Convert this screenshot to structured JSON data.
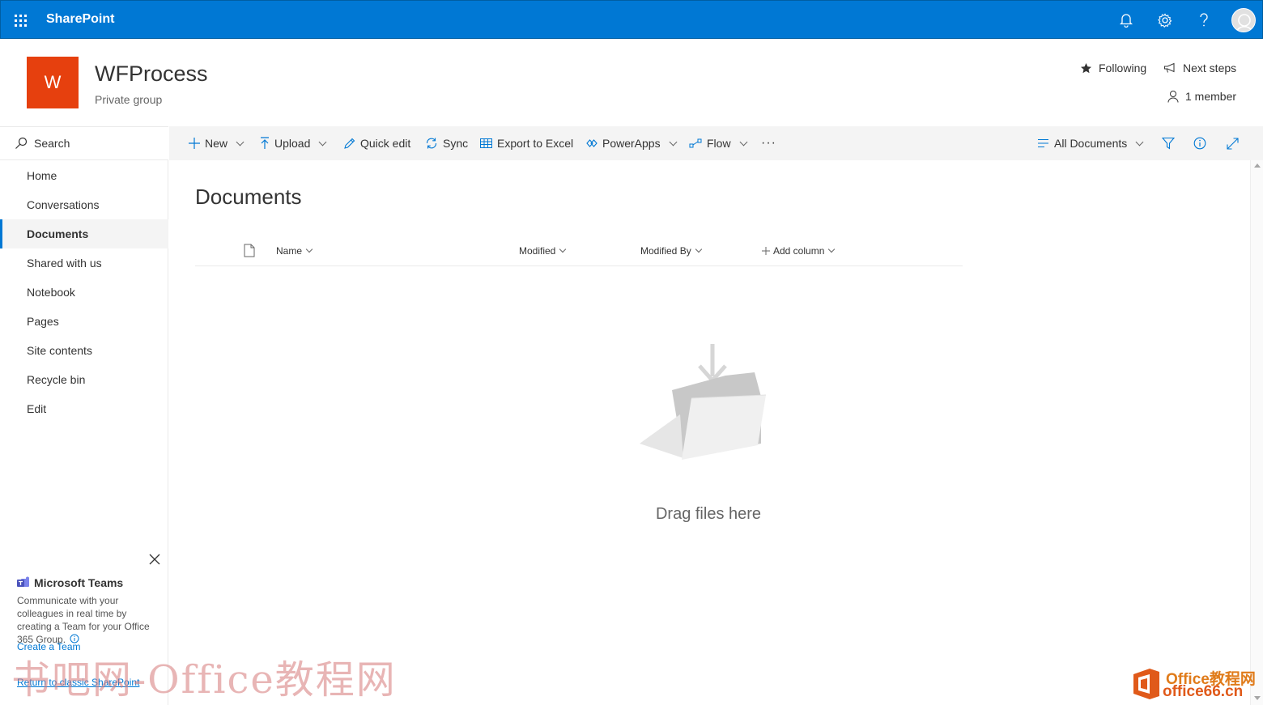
{
  "suite_bar": {
    "brand": "SharePoint",
    "color": "#0078d4",
    "icons": [
      "app-launcher-icon",
      "bell-icon",
      "gear-icon",
      "help-icon",
      "avatar"
    ]
  },
  "site": {
    "logo_letter": "W",
    "logo_color": "#e6400e",
    "title": "WFProcess",
    "subtitle": "Private group",
    "following_label": "Following",
    "next_steps_label": "Next steps",
    "members_label": "1 member"
  },
  "leftnav": {
    "search_label": "Search",
    "items": [
      {
        "label": "Home",
        "active": false
      },
      {
        "label": "Conversations",
        "active": false
      },
      {
        "label": "Documents",
        "active": true
      },
      {
        "label": "Shared with us",
        "active": false
      },
      {
        "label": "Notebook",
        "active": false
      },
      {
        "label": "Pages",
        "active": false
      },
      {
        "label": "Site contents",
        "active": false
      },
      {
        "label": "Recycle bin",
        "active": false
      },
      {
        "label": "Edit",
        "active": false
      }
    ],
    "teams": {
      "title": "Microsoft Teams",
      "description": "Communicate with your colleagues in real time by creating a Team for your Office 365 Group.",
      "create_link": "Create a Team",
      "classic_link": "Return to classic SharePoint"
    }
  },
  "commandbar": {
    "new": "New",
    "upload": "Upload",
    "quick_edit": "Quick edit",
    "sync": "Sync",
    "export": "Export to Excel",
    "powerapps": "PowerApps",
    "flow": "Flow",
    "more": "···",
    "view": "All Documents"
  },
  "main": {
    "title": "Documents",
    "columns": {
      "name": "Name",
      "modified": "Modified",
      "modified_by": "Modified By",
      "add_column": "Add column"
    },
    "empty_text": "Drag files here"
  },
  "watermarks": {
    "left": "书吧网-Office教程网",
    "right_line1": "Office教程网",
    "right_line2": "office66.cn"
  }
}
